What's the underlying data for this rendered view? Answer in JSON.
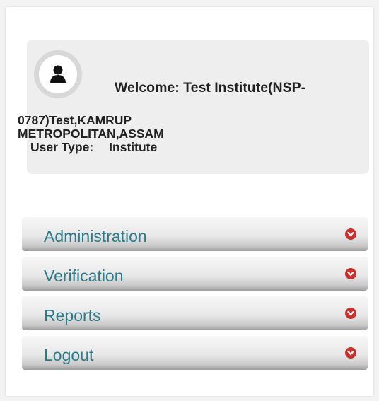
{
  "user": {
    "welcome_line1": "Welcome: Test Institute(NSP-",
    "welcome_line2": "0787)Test,KAMRUP",
    "welcome_line3": "METROPOLITAN,ASSAM",
    "user_type_label": "User Type:",
    "user_type_value": "Institute"
  },
  "menu": {
    "items": [
      {
        "label": "Administration",
        "icon": "chevron-down-circle-icon"
      },
      {
        "label": "Verification",
        "icon": "chevron-down-circle-icon"
      },
      {
        "label": "Reports",
        "icon": "chevron-down-circle-icon"
      },
      {
        "label": "Logout",
        "icon": "chevron-down-circle-icon"
      }
    ]
  },
  "colors": {
    "menu_text": "#2b7b8a",
    "chevron": "#c9302c",
    "welcome_bg": "#eeeeee"
  }
}
